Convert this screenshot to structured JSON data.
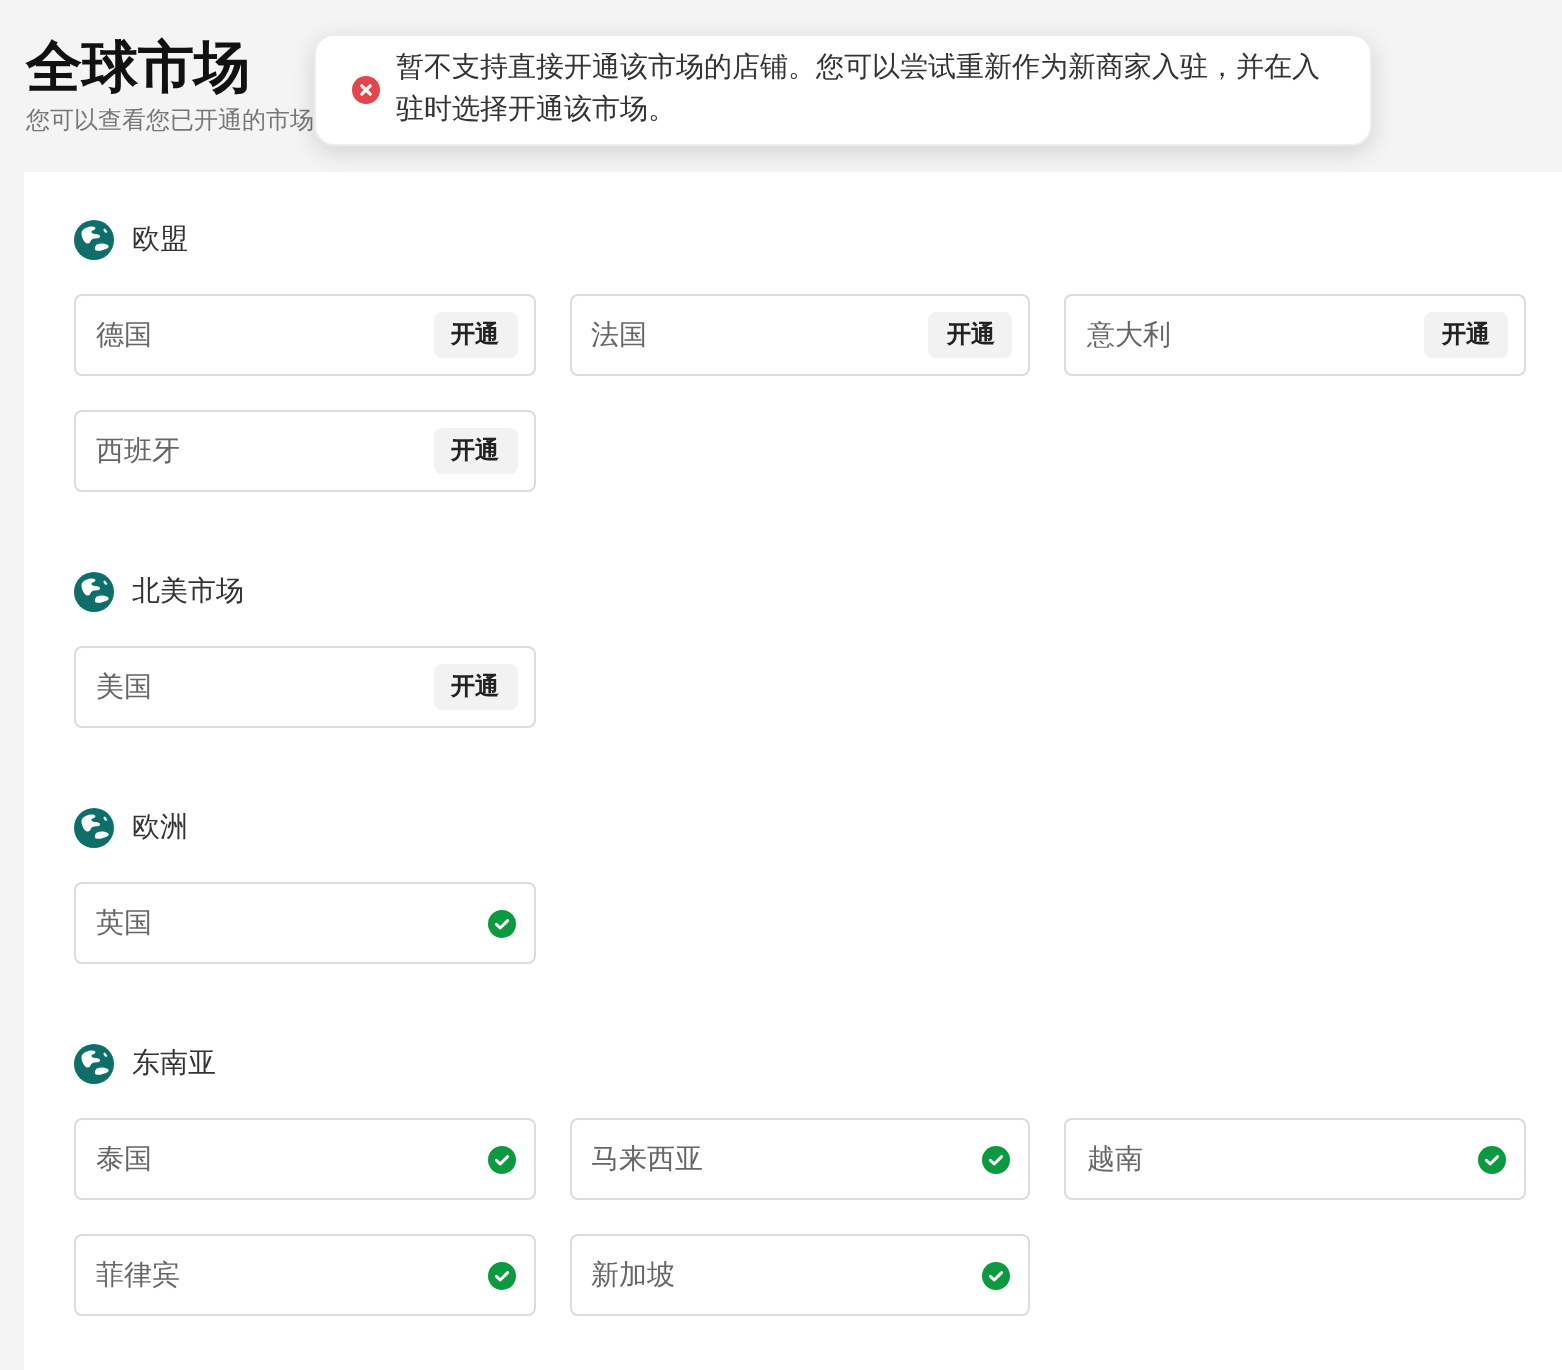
{
  "page": {
    "title": "全球市场",
    "subtitle": "您可以查看您已开通的市场"
  },
  "toast": {
    "kind": "error",
    "message": "暂不支持直接开通该市场的店铺。您可以尝试重新作为新商家入驻，并在入驻时选择开通该市场。"
  },
  "regions": [
    {
      "name": "欧盟",
      "markets": [
        {
          "name": "德国",
          "opened": false,
          "action": "开通"
        },
        {
          "name": "法国",
          "opened": false,
          "action": "开通"
        },
        {
          "name": "意大利",
          "opened": false,
          "action": "开通"
        },
        {
          "name": "西班牙",
          "opened": false,
          "action": "开通"
        }
      ]
    },
    {
      "name": "北美市场",
      "markets": [
        {
          "name": "美国",
          "opened": false,
          "action": "开通"
        }
      ]
    },
    {
      "name": "欧洲",
      "markets": [
        {
          "name": "英国",
          "opened": true
        }
      ]
    },
    {
      "name": "东南亚",
      "markets": [
        {
          "name": "泰国",
          "opened": true
        },
        {
          "name": "马来西亚",
          "opened": true
        },
        {
          "name": "越南",
          "opened": true
        },
        {
          "name": "菲律宾",
          "opened": true
        },
        {
          "name": "新加坡",
          "opened": true
        }
      ]
    }
  ]
}
